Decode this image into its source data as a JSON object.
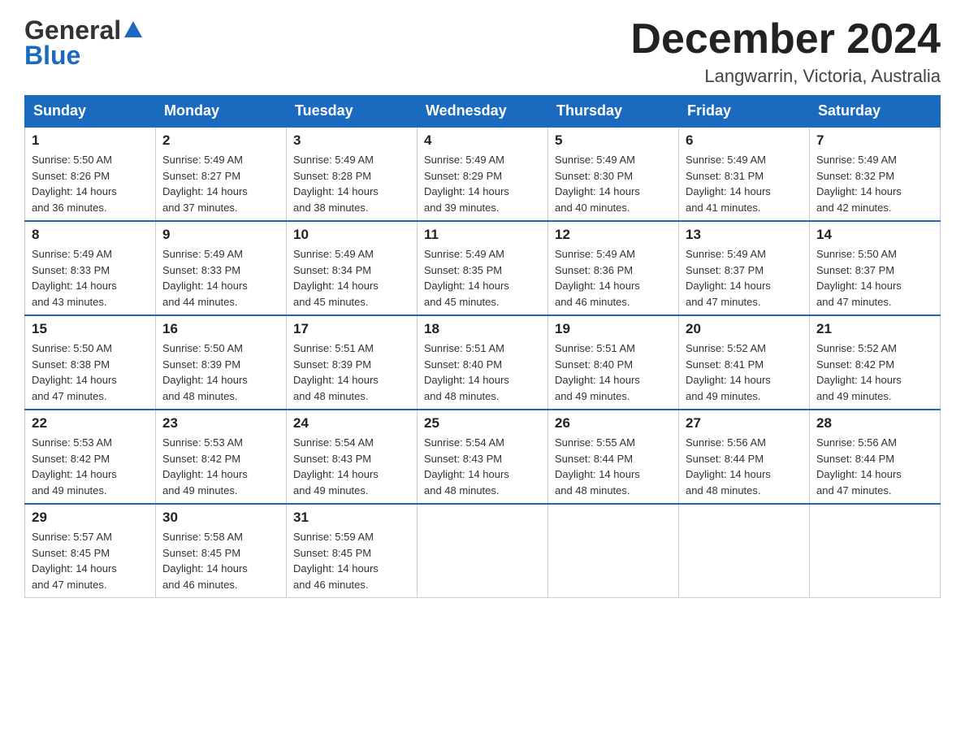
{
  "header": {
    "logo": {
      "line1": "General",
      "line2": "Blue"
    },
    "title": "December 2024",
    "location": "Langwarrin, Victoria, Australia"
  },
  "calendar": {
    "days_of_week": [
      "Sunday",
      "Monday",
      "Tuesday",
      "Wednesday",
      "Thursday",
      "Friday",
      "Saturday"
    ],
    "weeks": [
      [
        {
          "day": "1",
          "sunrise": "5:50 AM",
          "sunset": "8:26 PM",
          "daylight": "14 hours and 36 minutes."
        },
        {
          "day": "2",
          "sunrise": "5:49 AM",
          "sunset": "8:27 PM",
          "daylight": "14 hours and 37 minutes."
        },
        {
          "day": "3",
          "sunrise": "5:49 AM",
          "sunset": "8:28 PM",
          "daylight": "14 hours and 38 minutes."
        },
        {
          "day": "4",
          "sunrise": "5:49 AM",
          "sunset": "8:29 PM",
          "daylight": "14 hours and 39 minutes."
        },
        {
          "day": "5",
          "sunrise": "5:49 AM",
          "sunset": "8:30 PM",
          "daylight": "14 hours and 40 minutes."
        },
        {
          "day": "6",
          "sunrise": "5:49 AM",
          "sunset": "8:31 PM",
          "daylight": "14 hours and 41 minutes."
        },
        {
          "day": "7",
          "sunrise": "5:49 AM",
          "sunset": "8:32 PM",
          "daylight": "14 hours and 42 minutes."
        }
      ],
      [
        {
          "day": "8",
          "sunrise": "5:49 AM",
          "sunset": "8:33 PM",
          "daylight": "14 hours and 43 minutes."
        },
        {
          "day": "9",
          "sunrise": "5:49 AM",
          "sunset": "8:33 PM",
          "daylight": "14 hours and 44 minutes."
        },
        {
          "day": "10",
          "sunrise": "5:49 AM",
          "sunset": "8:34 PM",
          "daylight": "14 hours and 45 minutes."
        },
        {
          "day": "11",
          "sunrise": "5:49 AM",
          "sunset": "8:35 PM",
          "daylight": "14 hours and 45 minutes."
        },
        {
          "day": "12",
          "sunrise": "5:49 AM",
          "sunset": "8:36 PM",
          "daylight": "14 hours and 46 minutes."
        },
        {
          "day": "13",
          "sunrise": "5:49 AM",
          "sunset": "8:37 PM",
          "daylight": "14 hours and 47 minutes."
        },
        {
          "day": "14",
          "sunrise": "5:50 AM",
          "sunset": "8:37 PM",
          "daylight": "14 hours and 47 minutes."
        }
      ],
      [
        {
          "day": "15",
          "sunrise": "5:50 AM",
          "sunset": "8:38 PM",
          "daylight": "14 hours and 47 minutes."
        },
        {
          "day": "16",
          "sunrise": "5:50 AM",
          "sunset": "8:39 PM",
          "daylight": "14 hours and 48 minutes."
        },
        {
          "day": "17",
          "sunrise": "5:51 AM",
          "sunset": "8:39 PM",
          "daylight": "14 hours and 48 minutes."
        },
        {
          "day": "18",
          "sunrise": "5:51 AM",
          "sunset": "8:40 PM",
          "daylight": "14 hours and 48 minutes."
        },
        {
          "day": "19",
          "sunrise": "5:51 AM",
          "sunset": "8:40 PM",
          "daylight": "14 hours and 49 minutes."
        },
        {
          "day": "20",
          "sunrise": "5:52 AM",
          "sunset": "8:41 PM",
          "daylight": "14 hours and 49 minutes."
        },
        {
          "day": "21",
          "sunrise": "5:52 AM",
          "sunset": "8:42 PM",
          "daylight": "14 hours and 49 minutes."
        }
      ],
      [
        {
          "day": "22",
          "sunrise": "5:53 AM",
          "sunset": "8:42 PM",
          "daylight": "14 hours and 49 minutes."
        },
        {
          "day": "23",
          "sunrise": "5:53 AM",
          "sunset": "8:42 PM",
          "daylight": "14 hours and 49 minutes."
        },
        {
          "day": "24",
          "sunrise": "5:54 AM",
          "sunset": "8:43 PM",
          "daylight": "14 hours and 49 minutes."
        },
        {
          "day": "25",
          "sunrise": "5:54 AM",
          "sunset": "8:43 PM",
          "daylight": "14 hours and 48 minutes."
        },
        {
          "day": "26",
          "sunrise": "5:55 AM",
          "sunset": "8:44 PM",
          "daylight": "14 hours and 48 minutes."
        },
        {
          "day": "27",
          "sunrise": "5:56 AM",
          "sunset": "8:44 PM",
          "daylight": "14 hours and 48 minutes."
        },
        {
          "day": "28",
          "sunrise": "5:56 AM",
          "sunset": "8:44 PM",
          "daylight": "14 hours and 47 minutes."
        }
      ],
      [
        {
          "day": "29",
          "sunrise": "5:57 AM",
          "sunset": "8:45 PM",
          "daylight": "14 hours and 47 minutes."
        },
        {
          "day": "30",
          "sunrise": "5:58 AM",
          "sunset": "8:45 PM",
          "daylight": "14 hours and 46 minutes."
        },
        {
          "day": "31",
          "sunrise": "5:59 AM",
          "sunset": "8:45 PM",
          "daylight": "14 hours and 46 minutes."
        },
        null,
        null,
        null,
        null
      ]
    ],
    "labels": {
      "sunrise_prefix": "Sunrise: ",
      "sunset_prefix": "Sunset: ",
      "daylight_prefix": "Daylight: "
    }
  }
}
